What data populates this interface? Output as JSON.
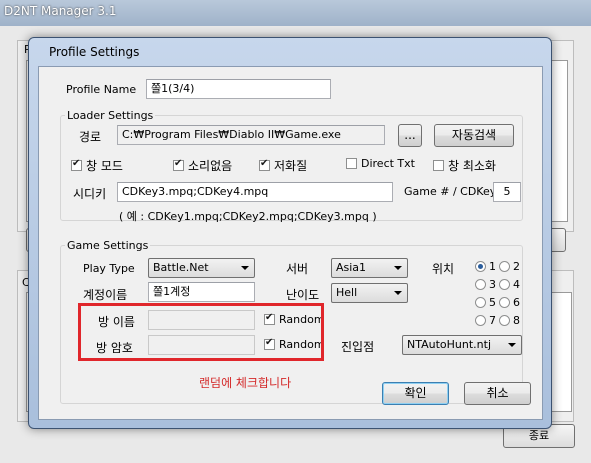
{
  "background": {
    "title": "D2NT Manager 3.1",
    "exit_label": "종료",
    "panel_letter_1": "Pr",
    "panel_letter_2": "Pr",
    "left_chars": [
      "가",
      "줄",
      "줄",
      "줄"
    ],
    "console_label": "Co"
  },
  "dialog": {
    "title": "Profile Settings",
    "profile_name_label": "Profile Name",
    "profile_name_value": "쫄1(3/4)",
    "loader": {
      "group_label": "Loader Settings",
      "path_label": "경로",
      "path_value": "C:₩Program Files₩Diablo II₩Game.exe",
      "browse_label": "...",
      "autodetect_label": "자동검색",
      "checkboxes": [
        {
          "label": "창 모드",
          "checked": true
        },
        {
          "label": "소리없음",
          "checked": true
        },
        {
          "label": "저화질",
          "checked": true
        },
        {
          "label": "Direct Txt",
          "checked": false
        },
        {
          "label": "창 최소화",
          "checked": false
        }
      ],
      "cdkey_label": "시디키",
      "cdkey_value": "CDKey3.mpq;CDKey4.mpq",
      "game_per_cdkey_label": "Game # / CDKey",
      "game_per_cdkey_value": "5",
      "example_text": "( 예 : CDKey1.mpq;CDKey2.mpq;CDKey3.mpq )"
    },
    "game": {
      "group_label": "Game Settings",
      "play_type_label": "Play Type",
      "play_type_value": "Battle.Net",
      "server_label": "서버",
      "server_value": "Asia1",
      "position_label": "위치",
      "account_label": "계정이름",
      "account_value": "쫄1계정",
      "difficulty_label": "난이도",
      "difficulty_value": "Hell",
      "room_name_label": "방 이름",
      "room_name_value": "",
      "room_pw_label": "방 암호",
      "room_pw_value": "",
      "random_label": "Random",
      "random_checked": true,
      "entry_label": "진입점",
      "entry_value": "NTAutoHunt.ntj",
      "positions": [
        "1",
        "2",
        "3",
        "4",
        "5",
        "6",
        "7",
        "8"
      ],
      "selected_position": "1"
    },
    "note": "랜덤에 체크합니다",
    "ok_label": "확인",
    "cancel_label": "취소"
  }
}
